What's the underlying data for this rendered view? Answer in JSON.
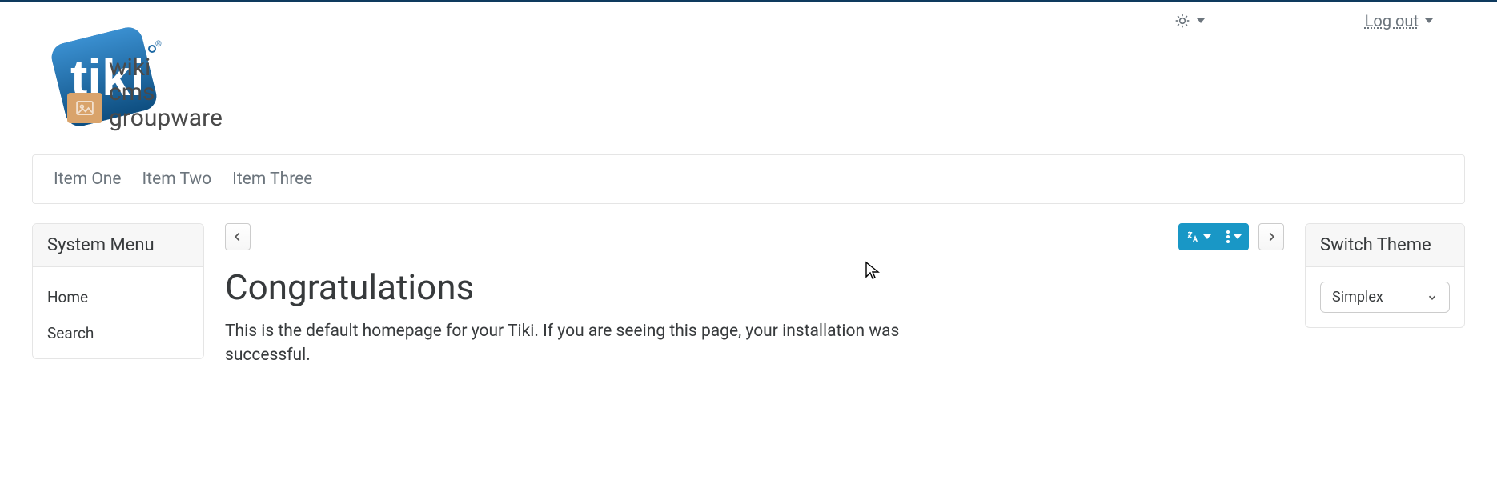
{
  "top_utils": {
    "theme_mode_icon": "sun",
    "logout_label": "Log out"
  },
  "logo_text": {
    "l1": "wiki",
    "l2": "cms",
    "l3": "groupware"
  },
  "navbar": {
    "items": [
      "Item One",
      "Item Two",
      "Item Three"
    ]
  },
  "sidebar_left": {
    "title": "System Menu",
    "items": [
      "Home",
      "Search"
    ]
  },
  "center": {
    "title": "Congratulations",
    "intro": "This is the default homepage for your Tiki. If you are seeing this page, your installation was successful."
  },
  "sidebar_right": {
    "title": "Switch Theme",
    "theme_selected": "Simplex"
  }
}
